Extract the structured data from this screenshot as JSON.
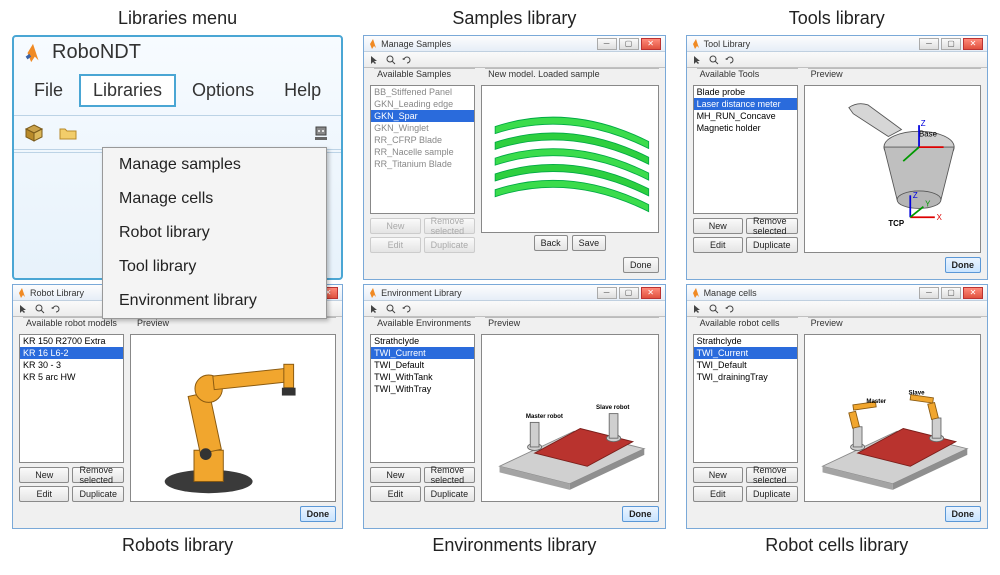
{
  "captions": {
    "menu": "Libraries menu",
    "samples": "Samples library",
    "tools": "Tools library",
    "robots": "Robots library",
    "environments": "Environments library",
    "cells": "Robot cells library"
  },
  "app": {
    "title": "RoboNDT",
    "menubar": [
      "File",
      "Libraries",
      "Options",
      "Help"
    ],
    "dropdown": [
      "Manage samples",
      "Manage cells",
      "Robot library",
      "Tool library",
      "Environment library"
    ]
  },
  "dlg": {
    "buttons": {
      "new": "New",
      "remove": "Remove selected",
      "edit": "Edit",
      "duplicate": "Duplicate",
      "done": "Done",
      "back": "Back",
      "save": "Save"
    }
  },
  "samples": {
    "title": "Manage Samples",
    "list_label": "Available Samples",
    "preview_label": "New model. Loaded sample",
    "items": [
      {
        "label": "BB_Stiffened Panel"
      },
      {
        "label": "GKN_Leading edge"
      },
      {
        "label": "GKN_Spar",
        "selected": true
      },
      {
        "label": "GKN_Winglet"
      },
      {
        "label": "RR_CFRP Blade"
      },
      {
        "label": "RR_Nacelle sample"
      },
      {
        "label": "RR_Titanium Blade"
      }
    ]
  },
  "tools": {
    "title": "Tool Library",
    "list_label": "Available Tools",
    "preview_label": "Preview",
    "items": [
      {
        "label": "Blade probe",
        "enabled": true
      },
      {
        "label": "Laser distance meter",
        "selected": true
      },
      {
        "label": "MH_RUN_Concave",
        "enabled": true
      },
      {
        "label": "Magnetic holder",
        "enabled": true
      }
    ]
  },
  "robots": {
    "title": "Robot Library",
    "list_label": "Available robot models",
    "preview_label": "Preview",
    "items": [
      {
        "label": "KR 150 R2700 Extra",
        "enabled": true
      },
      {
        "label": "KR 16 L6-2",
        "selected": true
      },
      {
        "label": "KR 30 - 3",
        "enabled": true
      },
      {
        "label": "KR 5 arc HW",
        "enabled": true
      }
    ]
  },
  "environments": {
    "title": "Environment Library",
    "list_label": "Available Environments",
    "preview_label": "Preview",
    "items": [
      {
        "label": "Strathclyde",
        "enabled": true
      },
      {
        "label": "TWI_Current",
        "selected": true
      },
      {
        "label": "TWI_Default",
        "enabled": true
      },
      {
        "label": "TWI_WithTank",
        "enabled": true
      },
      {
        "label": "TWI_WithTray",
        "enabled": true
      }
    ]
  },
  "cells": {
    "title": "Manage cells",
    "list_label": "Available robot cells",
    "preview_label": "Preview",
    "items": [
      {
        "label": "Strathclyde",
        "enabled": true
      },
      {
        "label": "TWI_Current",
        "selected": true
      },
      {
        "label": "TWI_Default",
        "enabled": true
      },
      {
        "label": "TWI_drainingTray",
        "enabled": true
      }
    ]
  }
}
